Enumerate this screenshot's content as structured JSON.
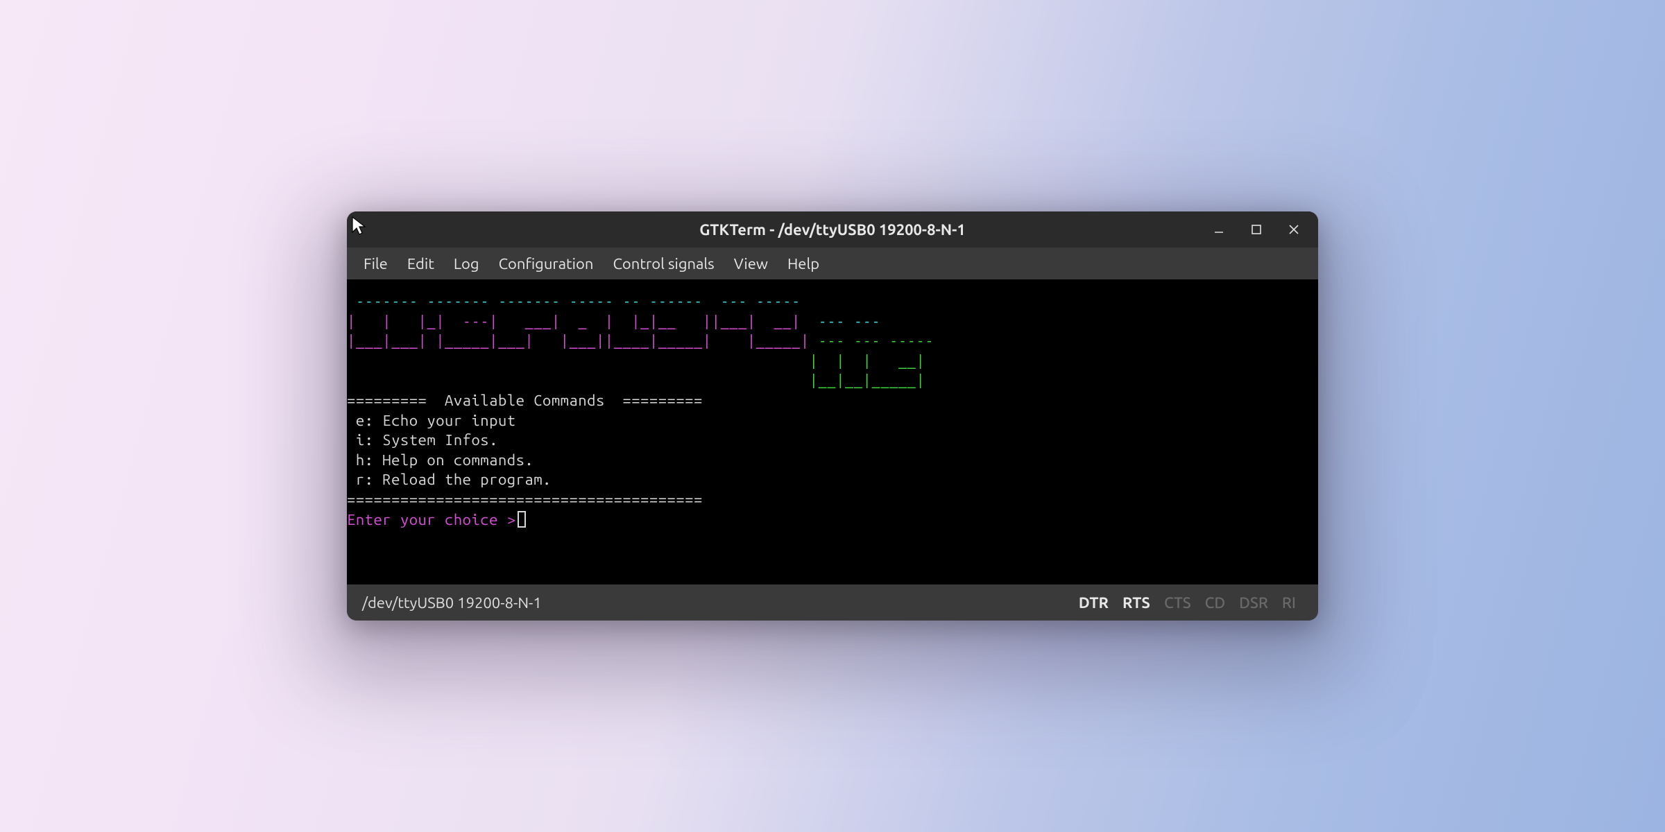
{
  "window": {
    "title": "GTKTerm - /dev/ttyUSB0  19200-8-N-1"
  },
  "menubar": {
    "items": [
      "File",
      "Edit",
      "Log",
      "Configuration",
      "Control signals",
      "View",
      "Help"
    ]
  },
  "terminal": {
    "ascii_art_cyan": " ------- ------- ------- ----- -- ------  --- ----- ",
    "ascii_art_magenta": "|   |   |_|  ---|   ___|  _  |  |_|__   ||___|  __| ",
    "ascii_art_magenta2": "|___|___| |_____|___|   |___||____|_____|    |_____|",
    "ascii_art_green1": "                                                    |  |  |   __|",
    "ascii_art_green2": "                                                    |__|__|_____|",
    "header": "=========  Available Commands  =========",
    "commands": [
      " e: Echo your input",
      " i: System Infos.",
      " h: Help on commands.",
      " r: Reload the program."
    ],
    "footer": "========================================",
    "prompt": "Enter your choice >"
  },
  "statusbar": {
    "device": "/dev/ttyUSB0 19200-8-N-1",
    "signals": [
      {
        "name": "DTR",
        "on": true
      },
      {
        "name": "RTS",
        "on": true
      },
      {
        "name": "CTS",
        "on": false
      },
      {
        "name": "CD",
        "on": false
      },
      {
        "name": "DSR",
        "on": false
      },
      {
        "name": "RI",
        "on": false
      }
    ]
  }
}
